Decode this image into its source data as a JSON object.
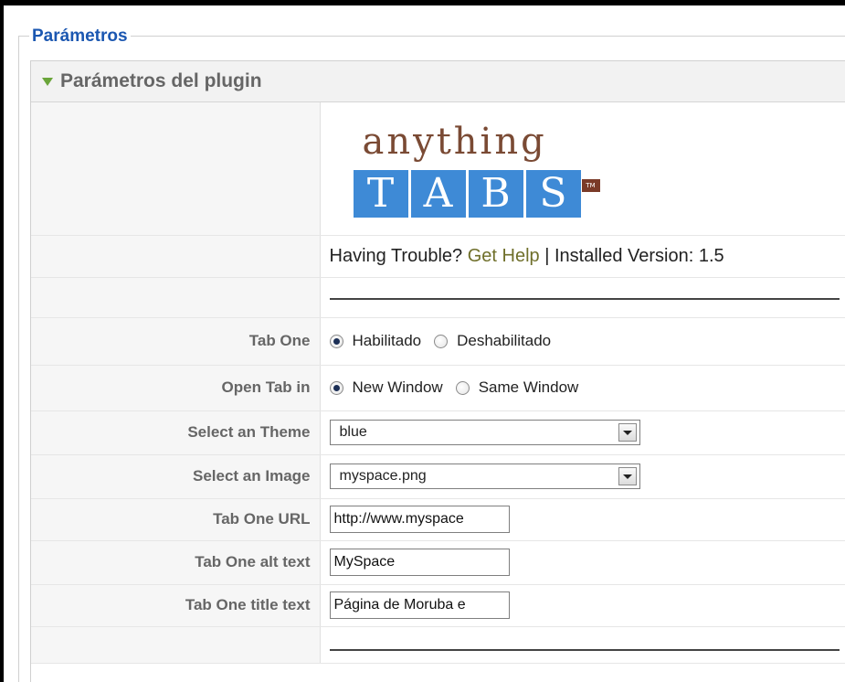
{
  "fieldset": {
    "legend": "Parámetros"
  },
  "panel": {
    "title": "Parámetros del plugin"
  },
  "logo": {
    "word": "anything",
    "letters": [
      "T",
      "A",
      "B",
      "S"
    ],
    "tm": "TM",
    "colors": {
      "word": "#7a4a34",
      "tabs": "#3e8ad6",
      "tm": "#7a3a28"
    }
  },
  "help": {
    "prefix": "Having Trouble?",
    "link": "Get Help",
    "separator": "|",
    "version_label": "Installed Version: 1.5"
  },
  "params": {
    "tab_one": {
      "label": "Tab One",
      "options": [
        "Habilitado",
        "Deshabilitado"
      ],
      "selected": "Habilitado"
    },
    "open_tab_in": {
      "label": "Open Tab in",
      "options": [
        "New Window",
        "Same Window"
      ],
      "selected": "New Window"
    },
    "theme": {
      "label": "Select an Theme",
      "value": "blue"
    },
    "image": {
      "label": "Select an Image",
      "value": "myspace.png"
    },
    "url": {
      "label": "Tab One URL",
      "value": "http://www.myspace"
    },
    "alt_text": {
      "label": "Tab One alt text",
      "value": "MySpace"
    },
    "title_text": {
      "label": "Tab One title text",
      "value": "Página de Moruba e"
    }
  },
  "colors": {
    "legend": "#1b57b1",
    "toggle": "#6aa53a",
    "link": "#6f6f2a"
  }
}
